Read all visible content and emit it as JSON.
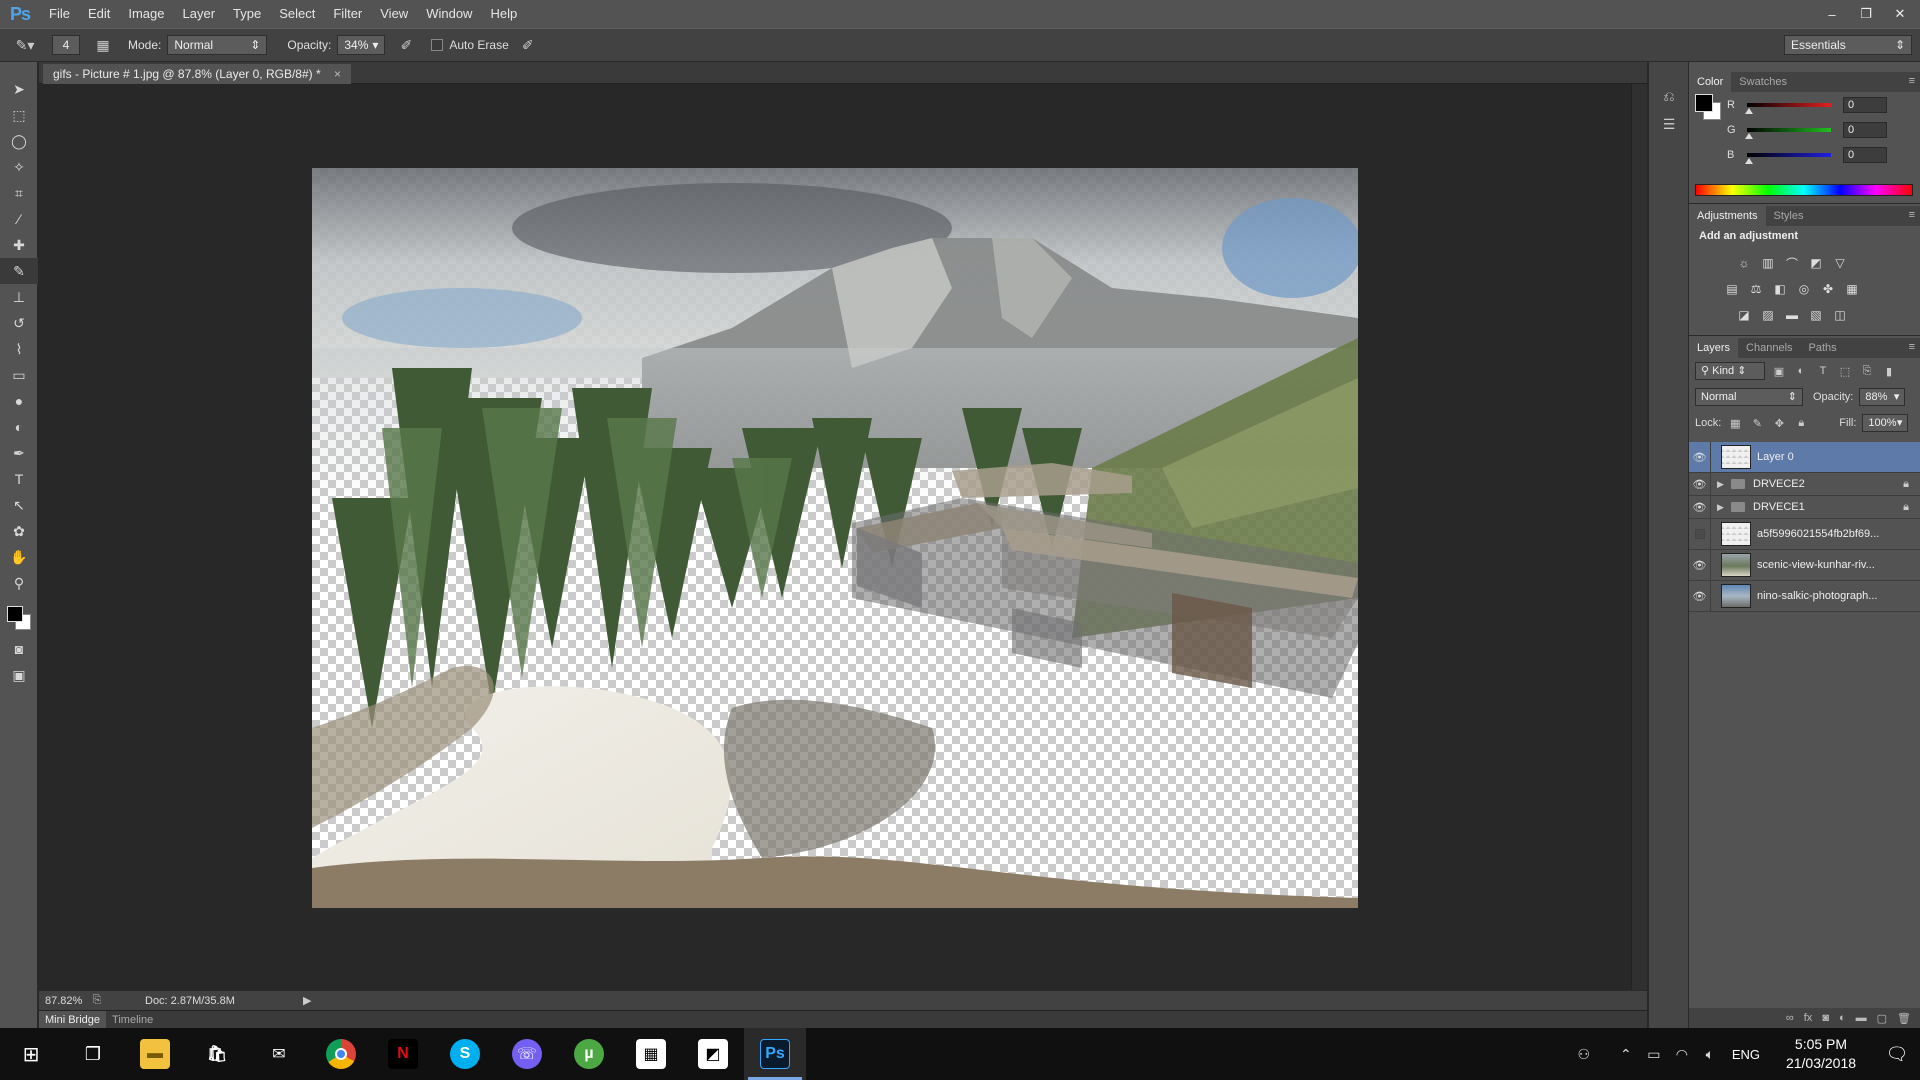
{
  "app": {
    "logo": "Ps"
  },
  "menu": [
    "File",
    "Edit",
    "Image",
    "Layer",
    "Type",
    "Select",
    "Filter",
    "View",
    "Window",
    "Help"
  ],
  "window_controls": {
    "minimize": "–",
    "restore": "❐",
    "close": "✕"
  },
  "options": {
    "brush_size": "4",
    "mode_label": "Mode:",
    "mode_value": "Normal",
    "opacity_label": "Opacity:",
    "opacity_value": "34%",
    "auto_erase_label": "Auto Erase",
    "workspace": "Essentials"
  },
  "document": {
    "tab_title": "gifs - Picture # 1.jpg @ 87.8% (Layer 0, RGB/8#) *",
    "tab_close": "×",
    "zoom": "87.82%",
    "doc_size": "Doc: 2.87M/35.8M"
  },
  "bottom_tabs": [
    "Mini Bridge",
    "Timeline"
  ],
  "color_panel": {
    "tabs": [
      "Color",
      "Swatches"
    ],
    "channels": [
      {
        "label": "R",
        "value": "0",
        "color": "#e02020"
      },
      {
        "label": "G",
        "value": "0",
        "color": "#20c020"
      },
      {
        "label": "B",
        "value": "0",
        "color": "#2020e0"
      }
    ]
  },
  "adjustments_panel": {
    "tabs": [
      "Adjustments",
      "Styles"
    ],
    "title": "Add an adjustment"
  },
  "layers_panel": {
    "tabs": [
      "Layers",
      "Channels",
      "Paths"
    ],
    "filter_kind": "Kind",
    "blend_mode": "Normal",
    "opacity_label": "Opacity:",
    "opacity_value": "88%",
    "lock_label": "Lock:",
    "fill_label": "Fill:",
    "fill_value": "100%",
    "layers": [
      {
        "name": "Layer 0",
        "visible": true,
        "selected": true,
        "type": "layer"
      },
      {
        "name": "DRVECE2",
        "visible": true,
        "selected": false,
        "type": "group",
        "locked": true
      },
      {
        "name": "DRVECE1",
        "visible": true,
        "selected": false,
        "type": "group",
        "locked": true
      },
      {
        "name": "a5f5996021554fb2bf69...",
        "visible": false,
        "selected": false,
        "type": "layer"
      },
      {
        "name": "scenic-view-kunhar-riv...",
        "visible": true,
        "selected": false,
        "type": "layer"
      },
      {
        "name": "nino-salkic-photograph...",
        "visible": true,
        "selected": false,
        "type": "layer"
      }
    ]
  },
  "taskbar": {
    "language": "ENG",
    "time": "5:05 PM",
    "date": "21/03/2018"
  }
}
